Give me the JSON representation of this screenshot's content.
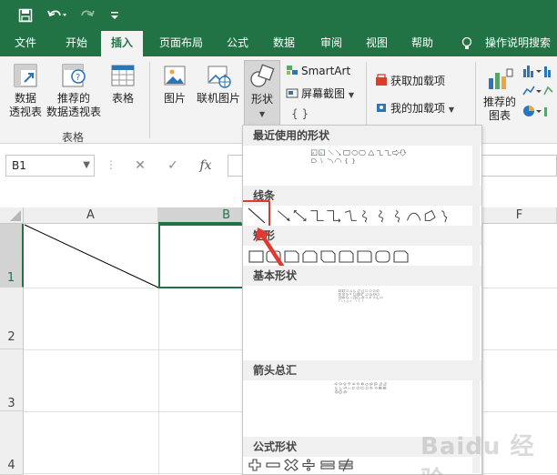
{
  "ribbon_tabs": [
    {
      "label": "文件"
    },
    {
      "label": "开始"
    },
    {
      "label": "插入"
    },
    {
      "label": "页面布局"
    },
    {
      "label": "公式"
    },
    {
      "label": "数据"
    },
    {
      "label": "审阅"
    },
    {
      "label": "视图"
    },
    {
      "label": "帮助"
    },
    {
      "label": "操作说明搜索"
    }
  ],
  "ribbon": {
    "pivot_table": "数据\n透视表",
    "pivot_line1": "数据",
    "pivot_line2": "透视表",
    "recommended_pivot_line1": "推荐的",
    "recommended_pivot_line2": "数据透视表",
    "table": "表格",
    "tables_group": "表格",
    "pictures": "图片",
    "online_pictures": "联机图片",
    "shapes": "形状",
    "smartart": "SmartArt",
    "screenshot": "屏幕截图",
    "get_addins": "获取加载项",
    "my_addins": "我的加载项",
    "recommended_charts_line1": "推荐的",
    "recommended_charts_line2": "图表"
  },
  "formula_bar": {
    "name_box": "B1",
    "fx": "fx"
  },
  "sheet": {
    "columns": [
      "A",
      "B",
      "F"
    ],
    "rows": [
      "1",
      "2",
      "3",
      "4"
    ]
  },
  "shapes_menu": {
    "sections": [
      {
        "label": "最近使用的形状"
      },
      {
        "label": "线条"
      },
      {
        "label": "矩形"
      },
      {
        "label": "基本形状"
      },
      {
        "label": "箭头总汇"
      },
      {
        "label": "公式形状"
      }
    ]
  },
  "colors": {
    "excel_green": "#217346",
    "highlight_red": "#e03a2f",
    "selection_green": "#217346"
  },
  "watermark": "Baidu 经验"
}
